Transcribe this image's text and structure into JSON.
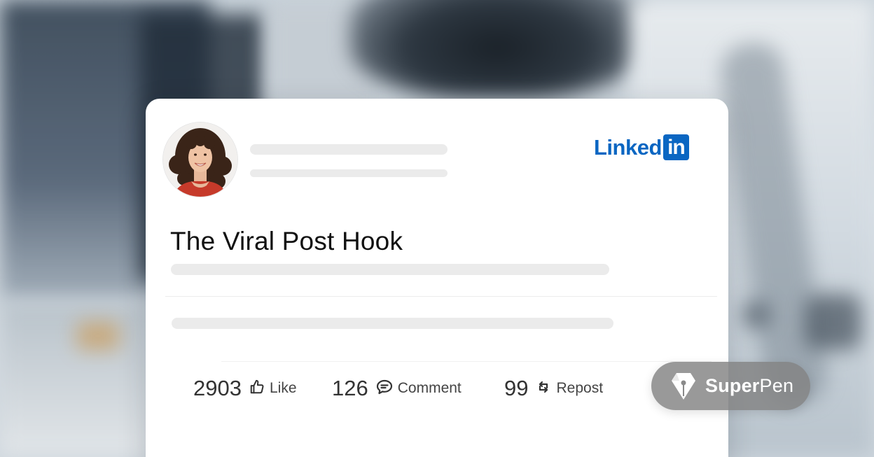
{
  "post": {
    "platform_logo": {
      "word": "Linked",
      "box": "in",
      "color": "#0a66c2"
    },
    "title": "The Viral Post Hook",
    "stats": {
      "likes": "2903",
      "like_label": "Like",
      "comments": "126",
      "comment_label": "Comment",
      "reposts": "99",
      "repost_label": "Repost"
    }
  },
  "badge": {
    "brand_bold": "Super",
    "brand_regular": "Pen"
  },
  "icons": {
    "like": "thumbs-up-icon",
    "comment": "comment-bubble-icon",
    "repost": "repost-arrows-icon",
    "brand": "pen-nib-icon"
  }
}
